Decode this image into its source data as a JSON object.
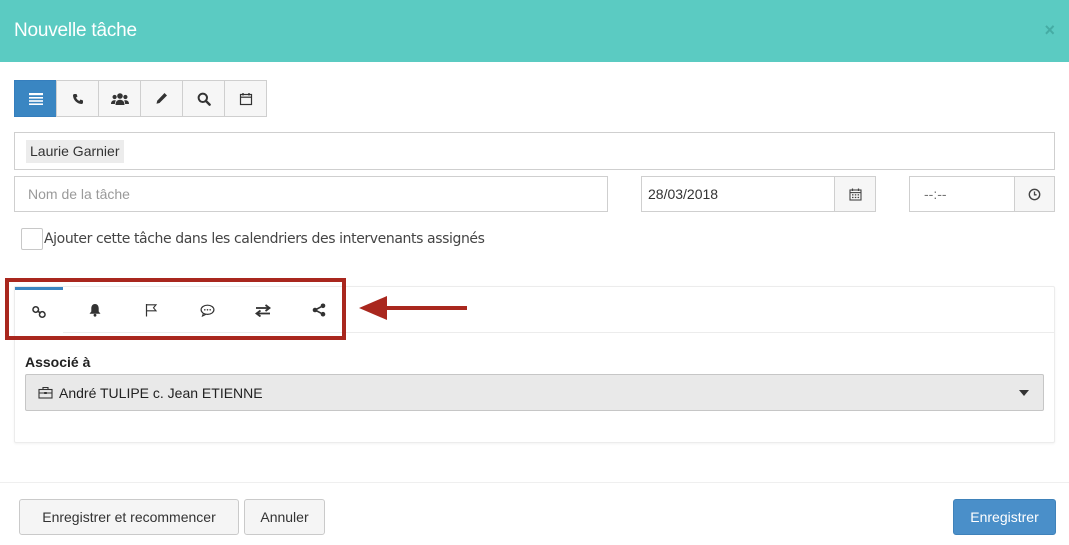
{
  "modal": {
    "title": "Nouvelle tâche",
    "close_symbol": "×"
  },
  "type_buttons": [
    {
      "icon": "list-icon",
      "active": true
    },
    {
      "icon": "phone-icon",
      "active": false
    },
    {
      "icon": "group-icon",
      "active": false
    },
    {
      "icon": "pencil-icon",
      "active": false
    },
    {
      "icon": "search-icon",
      "active": false
    },
    {
      "icon": "calendar-icon",
      "active": false
    }
  ],
  "assignee": {
    "chip_label": "Laurie Garnier"
  },
  "task": {
    "name_placeholder": "Nom de la tâche",
    "name_value": "",
    "date_value": "28/03/2018",
    "time_placeholder": "--:--"
  },
  "calendar_checkbox": {
    "label": "Ajouter cette tâche dans les calendriers des intervenants assignés",
    "checked": false
  },
  "tabs": [
    {
      "icon": "link-icon",
      "active": true
    },
    {
      "icon": "bell-icon",
      "active": false
    },
    {
      "icon": "flag-icon",
      "active": false
    },
    {
      "icon": "comment-icon",
      "active": false
    },
    {
      "icon": "exchange-icon",
      "active": false
    },
    {
      "icon": "share-icon",
      "active": false
    }
  ],
  "associated": {
    "label": "Associé à",
    "selected_value": "André TULIPE c. Jean ETIENNE",
    "icon": "briefcase-icon"
  },
  "footer": {
    "save_restart_label": "Enregistrer et recommencer",
    "cancel_label": "Annuler",
    "save_label": "Enregistrer"
  },
  "colors": {
    "header_bg": "#5bcbc2",
    "primary": "#3a86c2",
    "highlight": "#a9271e"
  }
}
